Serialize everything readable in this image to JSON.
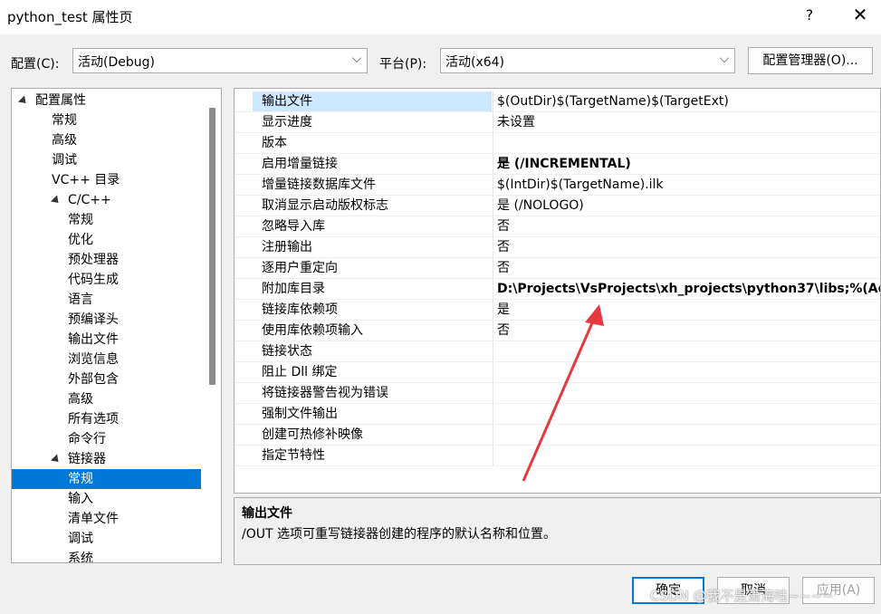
{
  "window": {
    "title": "python_test 属性页",
    "help_label": "?",
    "close_label": "✕"
  },
  "config_bar": {
    "config_label": "配置(C):",
    "config_value": "活动(Debug)",
    "platform_label": "平台(P):",
    "platform_value": "活动(x64)",
    "config_manager_label": "配置管理器(O)..."
  },
  "tree": {
    "items": [
      {
        "label": "配置属性",
        "level": 0,
        "expanded": true
      },
      {
        "label": "常规",
        "level": 1
      },
      {
        "label": "高级",
        "level": 1
      },
      {
        "label": "调试",
        "level": 1
      },
      {
        "label": "VC++ 目录",
        "level": 1
      },
      {
        "label": "C/C++",
        "level": 1,
        "expanded": true
      },
      {
        "label": "常规",
        "level": 2
      },
      {
        "label": "优化",
        "level": 2
      },
      {
        "label": "预处理器",
        "level": 2
      },
      {
        "label": "代码生成",
        "level": 2
      },
      {
        "label": "语言",
        "level": 2
      },
      {
        "label": "预编译头",
        "level": 2
      },
      {
        "label": "输出文件",
        "level": 2
      },
      {
        "label": "浏览信息",
        "level": 2
      },
      {
        "label": "外部包含",
        "level": 2
      },
      {
        "label": "高级",
        "level": 2
      },
      {
        "label": "所有选项",
        "level": 2
      },
      {
        "label": "命令行",
        "level": 2
      },
      {
        "label": "链接器",
        "level": 1,
        "expanded": true
      },
      {
        "label": "常规",
        "level": 2,
        "selected": true
      },
      {
        "label": "输入",
        "level": 2
      },
      {
        "label": "清单文件",
        "level": 2
      },
      {
        "label": "调试",
        "level": 2
      },
      {
        "label": "系统",
        "level": 2
      }
    ]
  },
  "properties": [
    {
      "name": "输出文件",
      "value": "$(OutDir)$(TargetName)$(TargetExt)",
      "bold": false,
      "selected": true
    },
    {
      "name": "显示进度",
      "value": "未设置",
      "bold": false
    },
    {
      "name": "版本",
      "value": "",
      "bold": false
    },
    {
      "name": "启用增量链接",
      "value": "是 (/INCREMENTAL)",
      "bold": true
    },
    {
      "name": "增量链接数据库文件",
      "value": "$(IntDir)$(TargetName).ilk",
      "bold": false
    },
    {
      "name": "取消显示启动版权标志",
      "value": "是 (/NOLOGO)",
      "bold": false
    },
    {
      "name": "忽略导入库",
      "value": "否",
      "bold": false
    },
    {
      "name": "注册输出",
      "value": "否",
      "bold": false
    },
    {
      "name": "逐用户重定向",
      "value": "否",
      "bold": false
    },
    {
      "name": "附加库目录",
      "value": "D:\\Projects\\VsProjects\\xh_projects\\python37\\libs;%(Ad",
      "bold": true
    },
    {
      "name": "链接库依赖项",
      "value": "是",
      "bold": false
    },
    {
      "name": "使用库依赖项输入",
      "value": "否",
      "bold": false
    },
    {
      "name": "链接状态",
      "value": "",
      "bold": false
    },
    {
      "name": "阻止 Dll 绑定",
      "value": "",
      "bold": false
    },
    {
      "name": "将链接器警告视为错误",
      "value": "",
      "bold": false
    },
    {
      "name": "强制文件输出",
      "value": "",
      "bold": false
    },
    {
      "name": "创建可热修补映像",
      "value": "",
      "bold": false
    },
    {
      "name": "指定节特性",
      "value": "",
      "bold": false
    }
  ],
  "description": {
    "title": "输出文件",
    "text": "/OUT 选项可重写链接器创建的程序的默认名称和位置。"
  },
  "buttons": {
    "ok": "确定",
    "cancel": "取消",
    "apply": "应用(A)"
  },
  "watermark": "CSDN @我不是萧海哇~~~~",
  "colors": {
    "selection": "#0078d7",
    "annotation_arrow": "#e8383d"
  }
}
